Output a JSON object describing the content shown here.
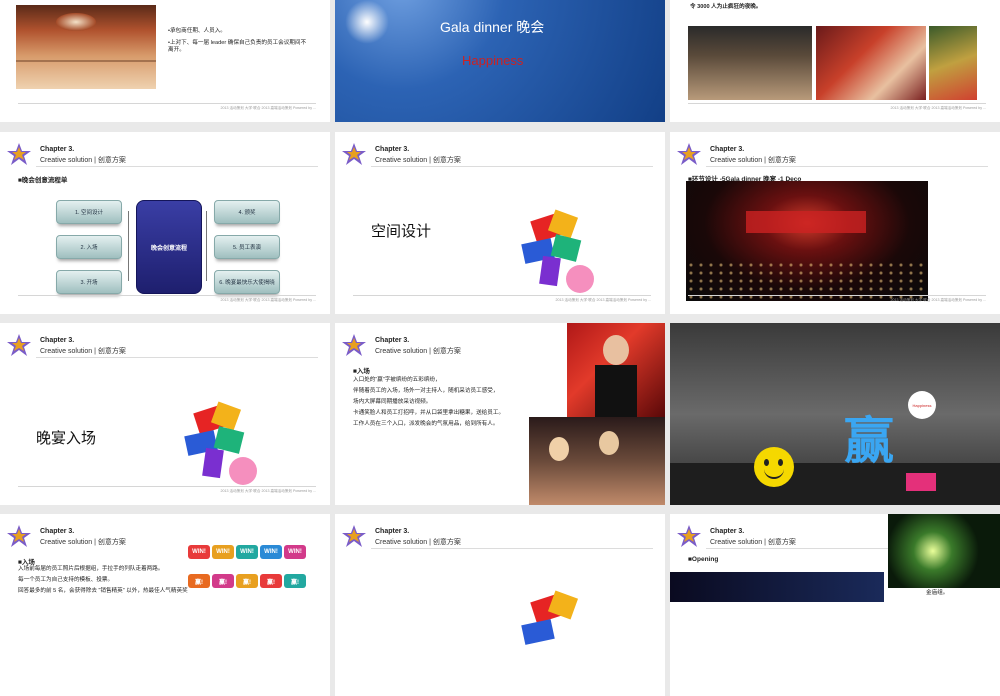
{
  "chapter": {
    "title": "Chapter 3.",
    "subtitle": "Creative solution | 创意方案"
  },
  "footer_text": "2013 活动策划 大学·联合 2013 高端活动策划 Powered by ...",
  "slide1": {
    "bullets": [
      "•承包商任期、人员入。",
      "•上对下、每一届 leader 确保自己负责的员工会议期间不离开。"
    ]
  },
  "slide2": {
    "title": "Gala dinner  晚会",
    "tagline": "Happiness",
    "accent": "#cc2222"
  },
  "slide3": {
    "top_text": "令 3000 人为止疯狂的夜晚。"
  },
  "slide4": {
    "section": "■晚会创意流程单",
    "center": "晚会创意流程",
    "left": [
      "1. 空间设计",
      "2. 入场",
      "3. 开场"
    ],
    "right": [
      "4. 颁奖",
      "5. 员工表演",
      "6. 晚宴最快乐大使揭晓"
    ]
  },
  "slide5": {
    "big": "空间设计"
  },
  "slide6": {
    "section": "■环节设计 -5Gala dinner  晚宴 -1 Deco"
  },
  "slide7": {
    "big": "晚宴入场"
  },
  "slide8": {
    "section": "■入场",
    "lines": [
      "入口处的“赢”字被缤纷的五彩缤纷，",
      "伴随着员工的入场，场外一对主持人，随机采访员工感受，",
      "场内大屏幕同期播放采访视频。",
      "卡通笑脸人和员工打招呼，并从口袋里拿出糖果，送给员工。",
      "工作人员在三个入口，派发晚会的气氛用品，给到所有人。"
    ]
  },
  "slide9": {
    "char": "赢",
    "badge": "Happiness"
  },
  "slide10": {
    "section": "■入场",
    "lines": [
      "入场前每届的员工照片后根据组，手拉手的列队走着两路。",
      "每一个员工为自己支持的模板、投票。",
      "回答最多的前 5 名，会获得除去 “销售精英” 以外，热最佳人气精英奖"
    ],
    "win_labels": [
      "WIN!",
      "WIN!",
      "WIN!",
      "WIN!",
      "WIN!"
    ],
    "ying_labels": [
      "赢!",
      "赢!",
      "赢!",
      "赢!",
      "赢!"
    ]
  },
  "slide12": {
    "section": "■Opening",
    "caption": "金庙组。"
  }
}
